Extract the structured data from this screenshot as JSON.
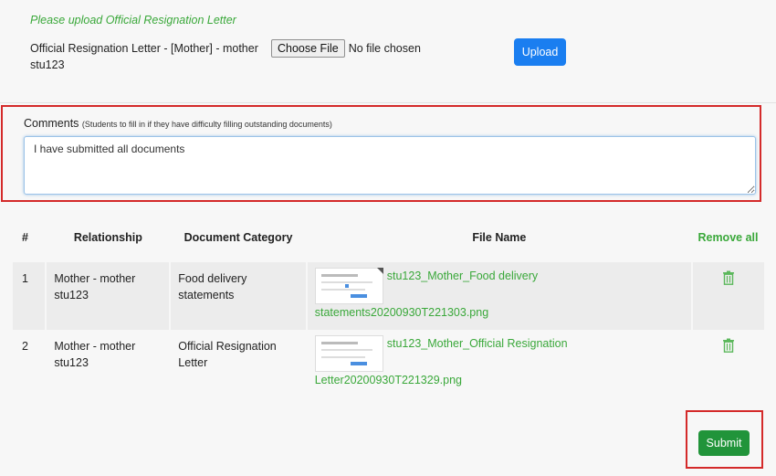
{
  "upload": {
    "hint": "Please upload Official Resignation Letter",
    "doc_label": "Official Resignation Letter - [Mother] - mother stu123",
    "choose_file_label": "Choose File",
    "no_file_text": "No file chosen",
    "upload_label": "Upload"
  },
  "comments": {
    "label": "Comments",
    "hint": "(Students to fill in if they have difficulty filling outstanding documents)",
    "value": "I have submitted all documents"
  },
  "table": {
    "headers": {
      "num": "#",
      "relationship": "Relationship",
      "category": "Document Category",
      "file_name": "File Name",
      "remove_all": "Remove all"
    },
    "rows": [
      {
        "num": "1",
        "relationship": "Mother - mother stu123",
        "category": "Food delivery statements",
        "file_part1": "stu123_Mother_Food delivery",
        "file_part2": "statements20200930T221303.png"
      },
      {
        "num": "2",
        "relationship": "Mother - mother stu123",
        "category": "Official Resignation Letter",
        "file_part1": "stu123_Mother_Official Resignation",
        "file_part2": "Letter20200930T221329.png"
      }
    ]
  },
  "submit": {
    "label": "Submit"
  },
  "colors": {
    "accent_green": "#3aa83a",
    "primary_blue": "#1a7ef0",
    "submit_green": "#21943a",
    "highlight_red": "#d42a2a"
  },
  "icons": [
    "trash-icon",
    "file-thumbnail-icon"
  ]
}
